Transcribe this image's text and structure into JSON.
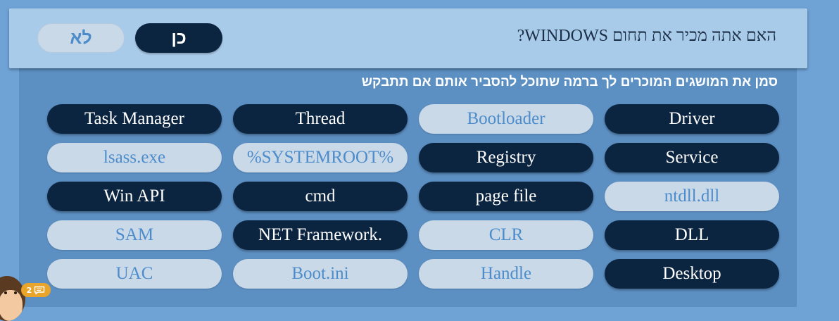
{
  "question": {
    "text": "האם אתה מכיר את תחום WINDOWS?",
    "yes_label": "כן",
    "no_label": "לא",
    "yes_selected": true
  },
  "instruction": "סמן את המושגים המוכרים לך ברמה שתוכל להסביר אותם אם תתבקש",
  "terms": [
    {
      "label": "Driver",
      "selected": true
    },
    {
      "label": "Bootloader",
      "selected": false
    },
    {
      "label": "Thread",
      "selected": true
    },
    {
      "label": "Task Manager",
      "selected": true
    },
    {
      "label": "Service",
      "selected": true
    },
    {
      "label": "Registry",
      "selected": true
    },
    {
      "label": "%SYSTEMROOT%",
      "selected": false
    },
    {
      "label": "lsass.exe",
      "selected": false
    },
    {
      "label": "ntdll.dll",
      "selected": false
    },
    {
      "label": "page file",
      "selected": true
    },
    {
      "label": "cmd",
      "selected": true
    },
    {
      "label": "Win API",
      "selected": true
    },
    {
      "label": "DLL",
      "selected": true
    },
    {
      "label": "CLR",
      "selected": false
    },
    {
      "label": "NET Framework.",
      "selected": true
    },
    {
      "label": "SAM",
      "selected": false
    },
    {
      "label": "Desktop",
      "selected": true
    },
    {
      "label": "Handle",
      "selected": false
    },
    {
      "label": "Boot.ini",
      "selected": false
    },
    {
      "label": "UAC",
      "selected": false
    }
  ],
  "chat": {
    "count": "2",
    "icon": "chat-bubble-icon"
  },
  "colors": {
    "selected_bg": "#0b2440",
    "unselected_bg": "#c9d9e8",
    "unselected_text": "#4d8ccb",
    "page_bg": "#6fa3d6",
    "card_bg": "#a9cbea",
    "panel_bg": "#5c8fc2",
    "badge_bg": "#e9a52a"
  }
}
